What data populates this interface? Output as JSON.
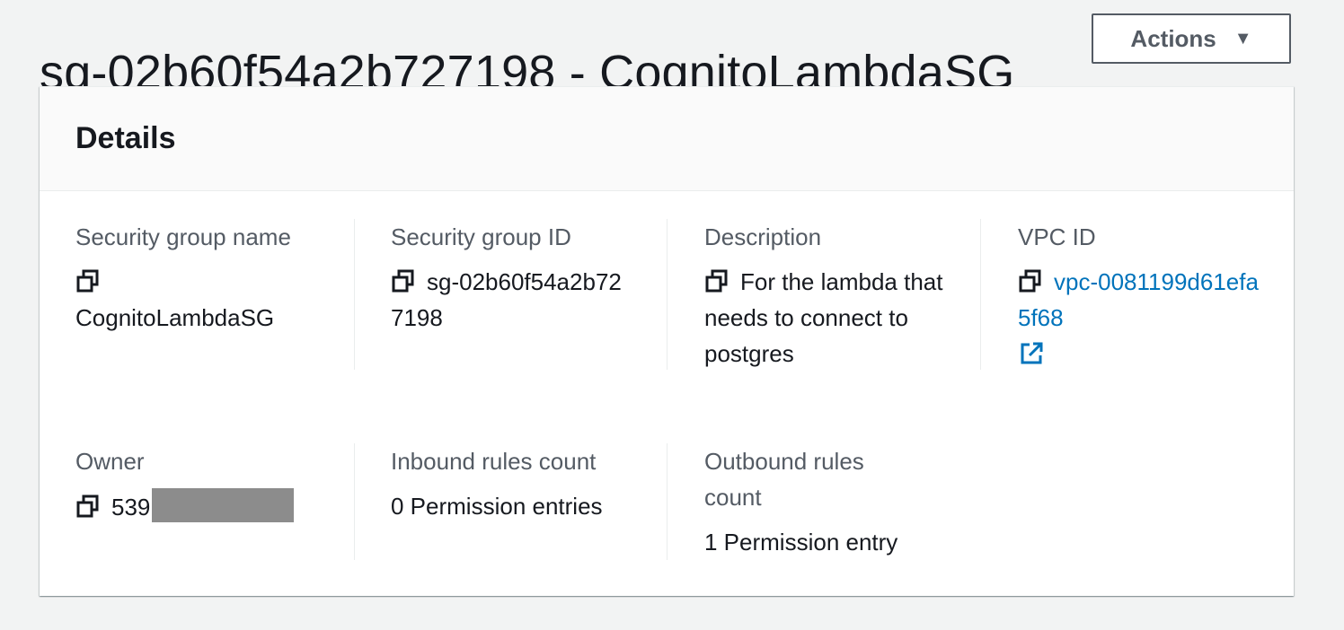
{
  "header": {
    "title": "sg-02b60f54a2b727198 - CognitoLambdaSG",
    "actions_label": "Actions"
  },
  "details": {
    "title": "Details",
    "security_group_name": {
      "label": "Security group name",
      "value": "CognitoLambdaSG"
    },
    "security_group_id": {
      "label": "Security group ID",
      "value": "sg-02b60f54a2b727198"
    },
    "description": {
      "label": "Description",
      "value": "For the lambda that needs to connect to postgres"
    },
    "vpc_id": {
      "label": "VPC ID",
      "value": "vpc-0081199d61efa5f68"
    },
    "owner": {
      "label": "Owner",
      "value_visible": "539"
    },
    "inbound": {
      "label": "Inbound rules count",
      "value": "0 Permission entries"
    },
    "outbound": {
      "label": "Outbound rules count",
      "value": "1 Permission entry"
    }
  },
  "colors": {
    "link": "#0073bb",
    "label": "#545b64",
    "text": "#16191f",
    "background": "#f2f3f3"
  },
  "icons": [
    "copy-icon",
    "external-link-icon",
    "caret-down-icon"
  ]
}
